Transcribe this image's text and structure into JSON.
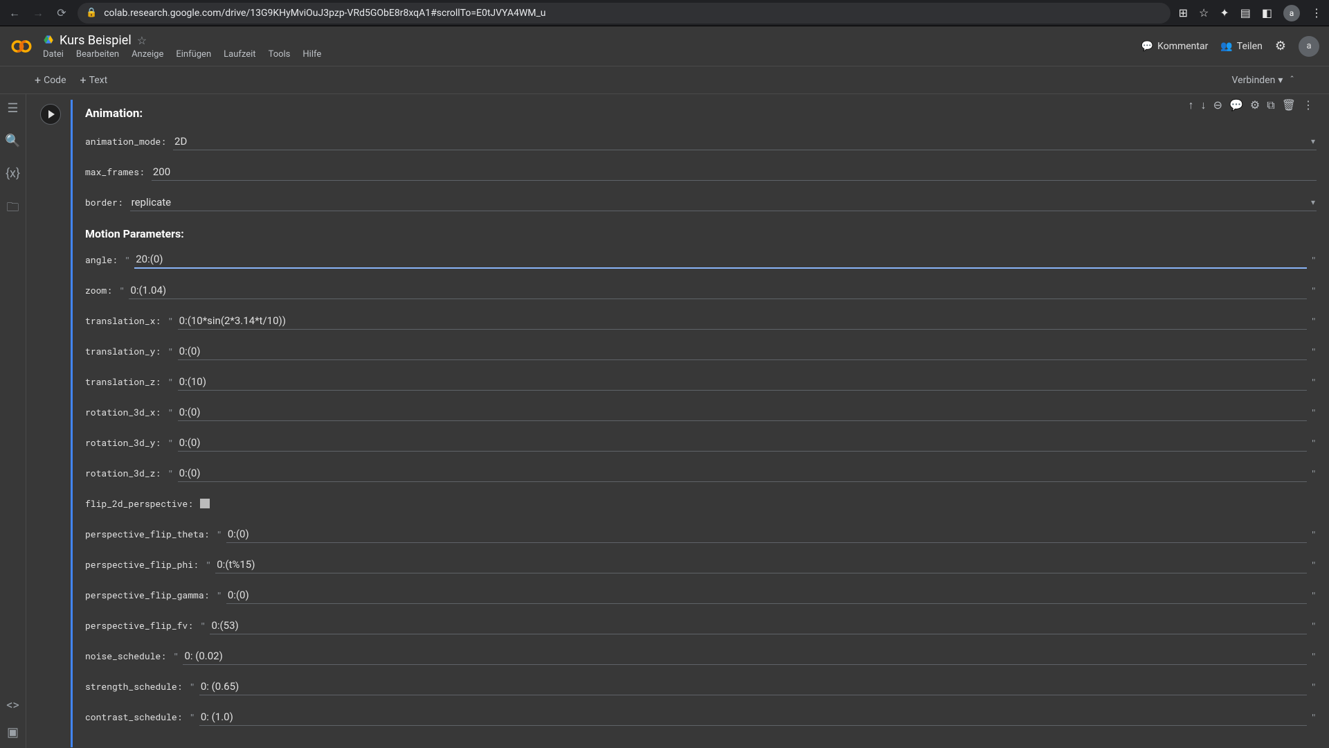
{
  "browser": {
    "url": "colab.research.google.com/drive/13G9KHyMviOuJ3pzp-VRd5GObE8r8xqA1#scrollTo=E0tJVYA4WM_u",
    "avatar": "a"
  },
  "header": {
    "title": "Kurs Beispiel",
    "menu": [
      "Datei",
      "Bearbeiten",
      "Anzeige",
      "Einfügen",
      "Laufzeit",
      "Tools",
      "Hilfe"
    ],
    "kommentar": "Kommentar",
    "teilen": "Teilen",
    "avatar": "a"
  },
  "toolbar": {
    "code": "Code",
    "text": "Text",
    "connect": "Verbinden"
  },
  "form": {
    "section1": "Animation:",
    "section2": "Motion Parameters:",
    "animation_mode": {
      "label": "animation_mode",
      "value": "2D"
    },
    "max_frames": {
      "label": "max_frames",
      "value": "200"
    },
    "border": {
      "label": "border",
      "value": "replicate"
    },
    "angle": {
      "label": "angle",
      "value": "20:(0)"
    },
    "zoom": {
      "label": "zoom",
      "value": "0:(1.04)"
    },
    "translation_x": {
      "label": "translation_x",
      "value": "0:(10*sin(2*3.14*t/10))"
    },
    "translation_y": {
      "label": "translation_y",
      "value": "0:(0)"
    },
    "translation_z": {
      "label": "translation_z",
      "value": "0:(10)"
    },
    "rotation_3d_x": {
      "label": "rotation_3d_x",
      "value": "0:(0)"
    },
    "rotation_3d_y": {
      "label": "rotation_3d_y",
      "value": "0:(0)"
    },
    "rotation_3d_z": {
      "label": "rotation_3d_z",
      "value": "0:(0)"
    },
    "flip_2d_perspective": {
      "label": "flip_2d_perspective"
    },
    "perspective_flip_theta": {
      "label": "perspective_flip_theta",
      "value": "0:(0)"
    },
    "perspective_flip_phi": {
      "label": "perspective_flip_phi",
      "value": "0:(t%15)"
    },
    "perspective_flip_gamma": {
      "label": "perspective_flip_gamma",
      "value": "0:(0)"
    },
    "perspective_flip_fv": {
      "label": "perspective_flip_fv",
      "value": "0:(53)"
    },
    "noise_schedule": {
      "label": "noise_schedule",
      "value": "0: (0.02)"
    },
    "strength_schedule": {
      "label": "strength_schedule",
      "value": "0: (0.65)"
    },
    "contrast_schedule": {
      "label": "contrast_schedule",
      "value": "0: (1.0)"
    }
  }
}
